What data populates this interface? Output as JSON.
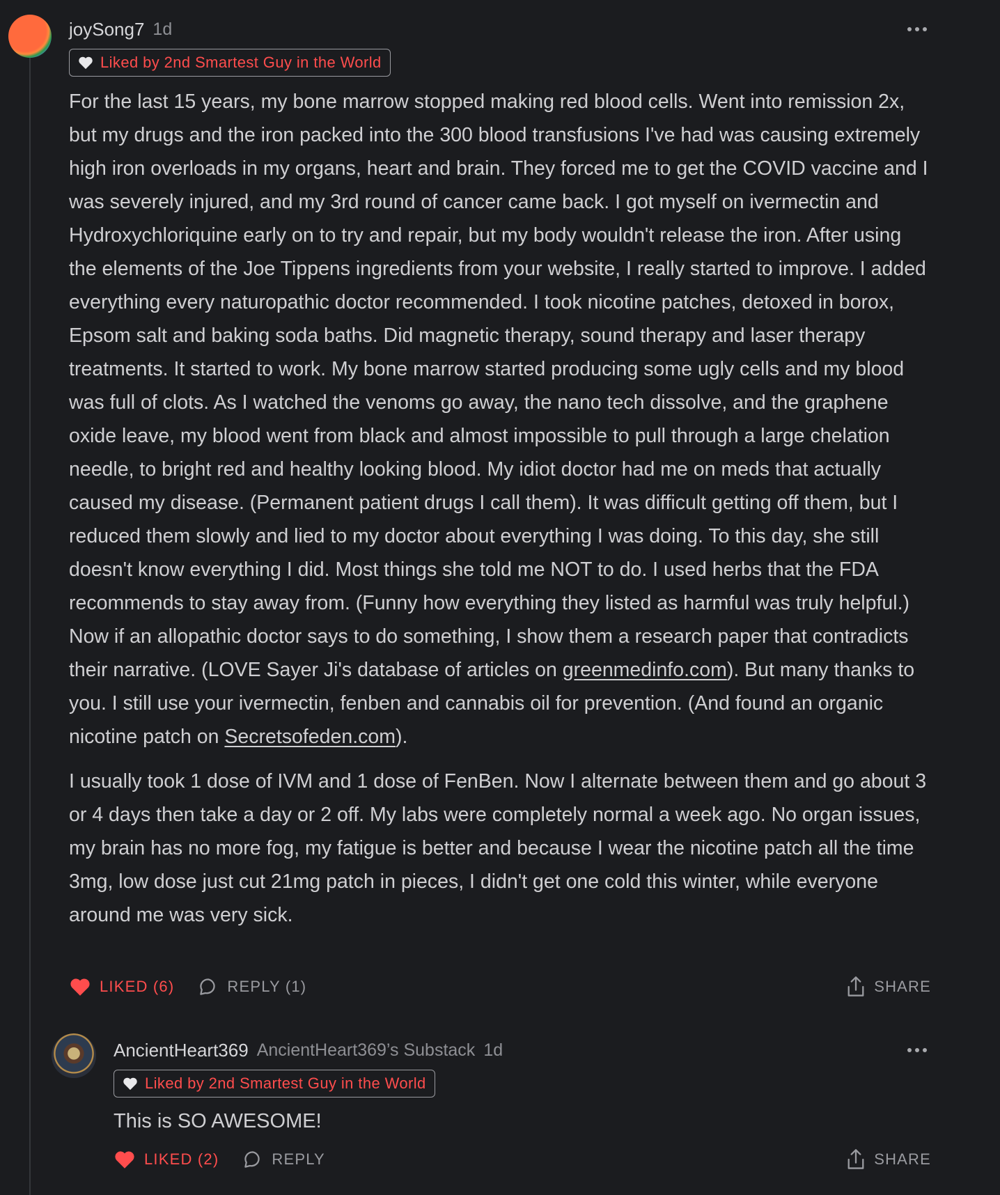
{
  "colors": {
    "background": "#1b1c1f",
    "text": "#cfcfd2",
    "muted": "#8e8f94",
    "liked_red": "#ff4d4d"
  },
  "comment": {
    "author": "joySong7",
    "time": "1d",
    "badge": "Liked by 2nd Smartest Guy in the World",
    "para1_a": "For the last 15 years, my bone marrow stopped making red blood cells. Went into remission 2x, but my drugs and the iron packed into the 300 blood transfusions I've had was causing extremely high iron overloads in my organs, heart and brain. They forced me to get the COVID vaccine and I was severely injured, and my 3rd round of cancer came back. I got myself on ivermectin and Hydroxychloriquine early on to try and repair, but my body wouldn't release the iron. After using the elements of the Joe Tippens ingredients from your website, I really started to improve. I added everything every naturopathic doctor recommended. I took nicotine patches, detoxed in borox, Epsom salt and baking soda baths. Did magnetic therapy, sound therapy and laser therapy treatments. It started to work. My bone marrow started producing some ugly cells and my blood was full of clots. As I watched the venoms go away, the nano tech dissolve, and the graphene oxide leave, my blood went from black and almost impossible to pull through a large chelation needle, to bright red and healthy looking blood. My idiot doctor had me on meds that actually caused my disease. (Permanent patient drugs I call them). It was difficult getting off them, but I reduced them slowly and lied to my doctor about everything I was doing. To this day, she still doesn't know everything I did. Most things she told me NOT to do. I used herbs that the FDA recommends to stay away from. (Funny how everything they listed as harmful was truly helpful.) Now if an allopathic doctor says to do something, I show them a research paper that contradicts their narrative. (LOVE Sayer Ji's database of articles on ",
    "link1": "greenmedinfo.com",
    "para1_b": "). But many thanks to you. I still use your ivermectin, fenben and cannabis oil for prevention. (And found an organic nicotine patch on ",
    "link2": "Secretsofeden.com",
    "para1_c": ").",
    "para2": "I usually took 1 dose of IVM and 1 dose of FenBen. Now I alternate between them and go about 3 or 4 days then take a day or 2 off. My labs were completely normal a week ago. No organ issues, my brain has no more fog, my fatigue is better and because I wear the nicotine patch all the time 3mg, low dose just cut 21mg patch in pieces, I didn't get one cold this winter, while everyone around me was very sick.",
    "liked_label": "LIKED (6)",
    "reply_label": "REPLY (1)",
    "share_label": "SHARE"
  },
  "reply": {
    "author": "AncientHeart369",
    "publication": "AncientHeart369’s Substack",
    "time": "1d",
    "badge": "Liked by 2nd Smartest Guy in the World",
    "text": "This is SO AWESOME!",
    "liked_label": "LIKED (2)",
    "reply_label": "REPLY",
    "share_label": "SHARE"
  },
  "icons": [
    "more-dots-icon",
    "heart-icon",
    "comment-bubble-icon",
    "share-icon"
  ]
}
